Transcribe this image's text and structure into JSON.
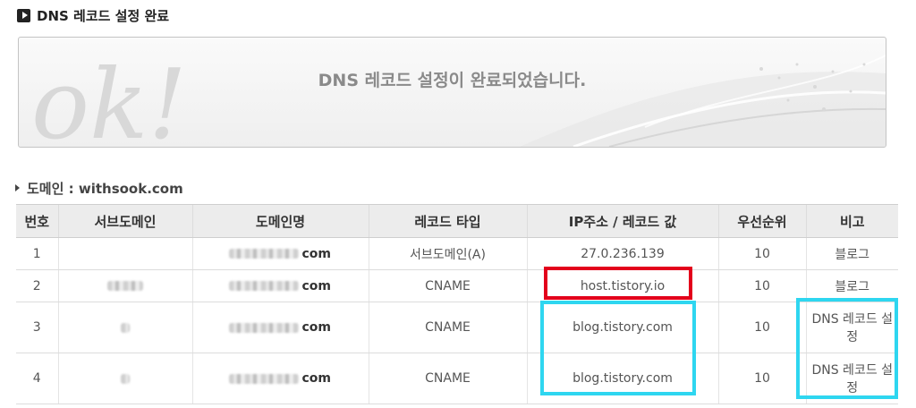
{
  "header": {
    "title": "DNS 레코드 설정 완료"
  },
  "banner": {
    "art_text": "ok!",
    "message": "DNS 레코드 설정이 완료되었습니다."
  },
  "domain_line": {
    "text": "도메인 : withsook.com"
  },
  "table": {
    "columns": [
      "번호",
      "서브도메인",
      "도메인명",
      "레코드 타입",
      "IP주소 / 레코드 값",
      "우선순위",
      "비고"
    ],
    "rows": [
      {
        "no": "1",
        "domain_suffix": "com",
        "type": "서브도메인(A)",
        "value": "27.0.236.139",
        "priority": "10",
        "note": "블로그"
      },
      {
        "no": "2",
        "domain_suffix": "com",
        "type": "CNAME",
        "value": "host.tistory.io",
        "priority": "10",
        "note": "블로그"
      },
      {
        "no": "3",
        "domain_suffix": "com",
        "type": "CNAME",
        "value": "blog.tistory.com",
        "priority": "10",
        "note": "DNS 레코드 설정"
      },
      {
        "no": "4",
        "domain_suffix": "com",
        "type": "CNAME",
        "value": "blog.tistory.com",
        "priority": "10",
        "note": "DNS 레코드 설정"
      }
    ]
  },
  "colors": {
    "highlight_red": "#e3001b",
    "highlight_cyan": "#2ed6f0"
  }
}
